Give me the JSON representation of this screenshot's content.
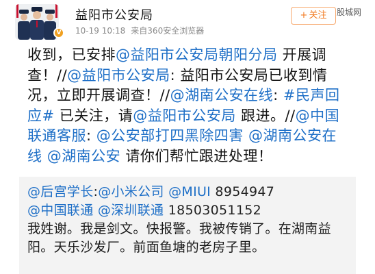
{
  "header": {
    "username": "益阳市公安局",
    "date": "10-19",
    "time": "10:18",
    "source": "来自360安全浏览器",
    "follow_label": "关注",
    "follow_icon": "plus-icon",
    "verified_icon": "verified-badge-icon",
    "watermark": "股城网"
  },
  "content": {
    "t1": "收到，已安排",
    "m1": "@益阳市公安局朝阳分局",
    "t2": " 开展调查！//",
    "m2": "@益阳市公安局",
    "t3": ": 益阳市公安局已收到情况，立即开展调查！//",
    "m3": "@湖南公安在线",
    "t4": ": ",
    "tag1": "#民声回应#",
    "t5": " 已关注，请",
    "m4": "@益阳市公安局",
    "t6": " 跟进。//",
    "m5": "@中国联通客服",
    "t7": ": ",
    "m6": "@公安部打四黑除四害",
    "t8": " ",
    "m7": "@湖南公安在线",
    "t9": " ",
    "m8": "@湖南公安",
    "t10": " 请你们帮忙跟进处理！"
  },
  "repost": {
    "m1": "@后宫学长",
    "t1": ":",
    "m2": "@小米公司",
    "t2": " ",
    "m3": "@MIUI",
    "t3": " 8954947",
    "m4": "@中国联通",
    "t4": " ",
    "m5": "@深圳联通",
    "t5": " 18503051152",
    "t6": "我姓谢。我是剑文。快报警。我被传销了。在湖南益阳。天乐沙发厂。前面鱼塘的老房子里。"
  },
  "colors": {
    "link": "#1e6fc7",
    "follow": "#f27b22",
    "meta": "#8a8a8a",
    "repost_bg": "#f3f3f3"
  }
}
